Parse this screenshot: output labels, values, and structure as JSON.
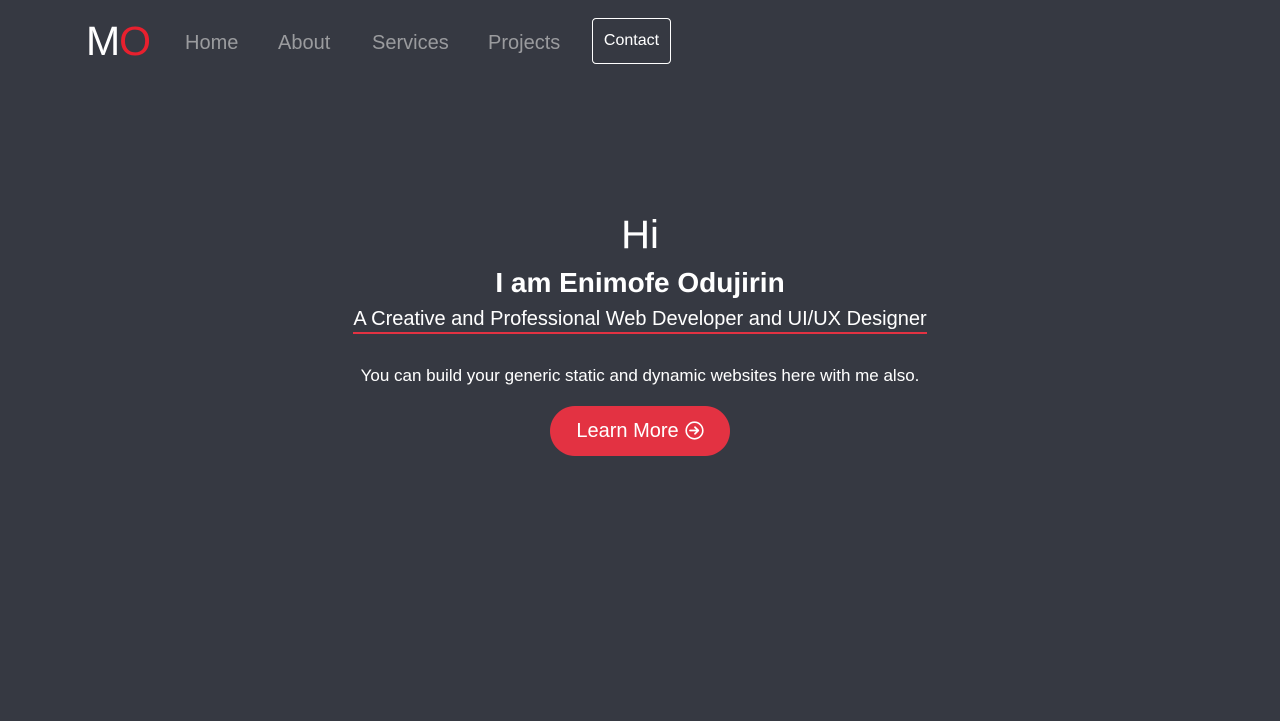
{
  "nav": {
    "logo_first": "M",
    "logo_second": "O",
    "links": [
      {
        "label": "Home"
      },
      {
        "label": "About"
      },
      {
        "label": "Services"
      },
      {
        "label": "Projects"
      }
    ],
    "contact_label": "Contact"
  },
  "hero": {
    "greeting": "Hi",
    "name": "I am Enimofe Odujirin",
    "tagline": "A Creative and Professional Web Developer and UI/UX Designer",
    "description": "You can build your generic static and dynamic websites here with me also.",
    "cta_label": "Learn More",
    "cta_icon": "arrow-circle-right-icon"
  },
  "colors": {
    "background": "#363942",
    "accent": "#e33242",
    "logo_accent": "#e8202e",
    "nav_link": "#9a9b9e",
    "text": "#ffffff"
  }
}
